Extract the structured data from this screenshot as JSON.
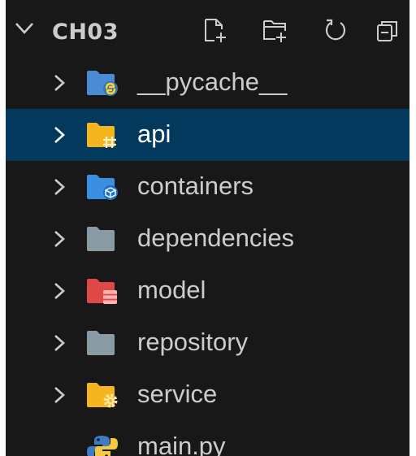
{
  "explorer": {
    "section_title": "CH03",
    "actions": [
      {
        "name": "new-file",
        "icon": "new-file-icon"
      },
      {
        "name": "new-folder",
        "icon": "new-folder-icon"
      },
      {
        "name": "refresh",
        "icon": "refresh-icon"
      },
      {
        "name": "collapse-all",
        "icon": "collapse-all-icon"
      }
    ],
    "items": [
      {
        "label": "__pycache__",
        "type": "folder",
        "icon": "pycache-folder-icon",
        "color": "#4b8bd6"
      },
      {
        "label": "api",
        "type": "folder",
        "icon": "api-folder-icon",
        "color": "#f4b51f",
        "selected": true
      },
      {
        "label": "containers",
        "type": "folder",
        "icon": "containers-folder-icon",
        "color": "#3a8fe0"
      },
      {
        "label": "dependencies",
        "type": "folder",
        "icon": "folder-icon",
        "color": "#8a9aa4"
      },
      {
        "label": "model",
        "type": "folder",
        "icon": "model-folder-icon",
        "color": "#e04848"
      },
      {
        "label": "repository",
        "type": "folder",
        "icon": "folder-icon",
        "color": "#8a9aa4"
      },
      {
        "label": "service",
        "type": "folder",
        "icon": "service-folder-icon",
        "color": "#f4b51f"
      },
      {
        "label": "main.py",
        "type": "file",
        "icon": "python-file-icon",
        "color": "#3776ab"
      }
    ]
  }
}
